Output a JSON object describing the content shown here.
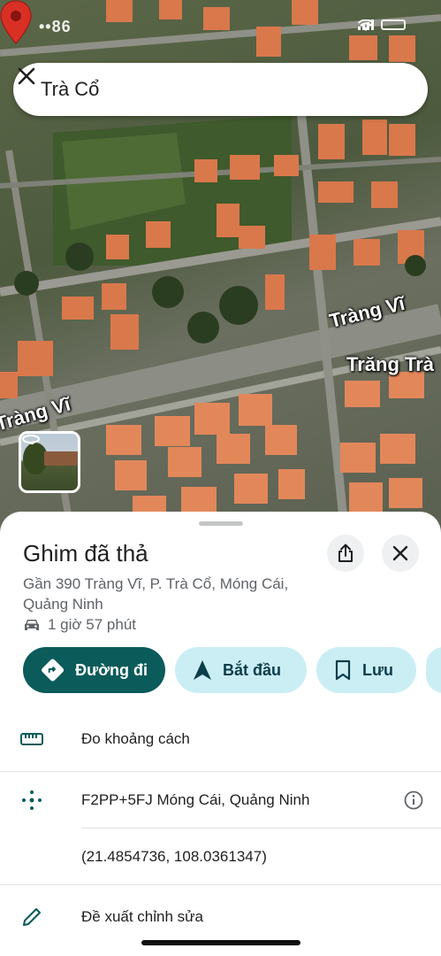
{
  "status_bar": {
    "carrier_text": "••86",
    "network": "wifi"
  },
  "search": {
    "query": "Trà Cổ"
  },
  "map": {
    "street_labels": [
      "Tràng Vĩ",
      "Trăng Trà",
      "Tràng Vĩ"
    ],
    "pin_color": "#d93025"
  },
  "place": {
    "title": "Ghim đã thả",
    "address": "Gần 390 Tràng Vĩ, P. Trà Cổ, Móng Cái, Quảng Ninh",
    "drive_time": "1 giờ 57 phút"
  },
  "actions": {
    "directions": "Đường đi",
    "start": "Bắt đầu",
    "save": "Lưu"
  },
  "details": {
    "measure": "Đo khoảng cách",
    "plus_code": "F2PP+5FJ Móng Cái, Quảng Ninh",
    "coordinates": "(21.4854736, 108.0361347)",
    "suggest_edit": "Đề xuất chỉnh sửa"
  },
  "colors": {
    "primary": "#0b5b5b",
    "secondary_chip": "#cbeef5",
    "accent": "#0b5b5b"
  }
}
